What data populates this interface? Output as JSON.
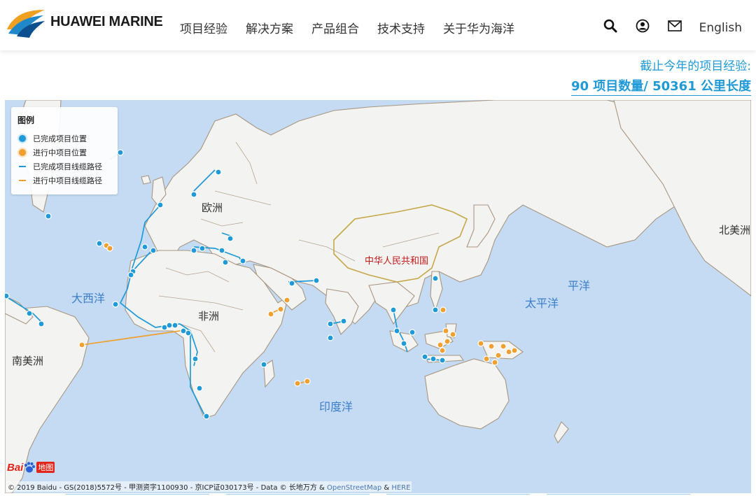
{
  "header": {
    "brand": "HUAWEI MARINE",
    "nav": [
      "项目经验",
      "解决方案",
      "产品组合",
      "技术支持",
      "关于华为海洋"
    ],
    "icons": [
      "search-icon",
      "user-icon",
      "mail-icon"
    ],
    "language": "English"
  },
  "stats": {
    "line1": "截止今年的项目经验:",
    "line2": "90 项目数量/ 50361 公里长度"
  },
  "legend": {
    "title": "图例",
    "items": [
      {
        "label": "已完成项目位置",
        "color": "#1f9ad7"
      },
      {
        "label": "进行中项目位置",
        "color": "#f0a030"
      },
      {
        "label": "已完成项目线缆路径",
        "color": "#1f9ad7"
      },
      {
        "label": "进行中项目线缆路径",
        "color": "#f0a030"
      }
    ]
  },
  "map": {
    "labels": {
      "europe": "欧洲",
      "africa": "非洲",
      "south_america": "南美洲",
      "north_america": "北美洲",
      "china": "中华人民共和国",
      "atlantic": "大西洋",
      "pacific_a": "平洋",
      "pacific_b": "太平洋",
      "indian": "印度洋"
    },
    "provider": {
      "bai": "Bai",
      "ditu": "地图"
    },
    "copyright_prefix": "© 2019 Baidu - GS(2018)5572号 - 甲测资字1100930 - 京ICP证030173号 - Data © 长地万方 & ",
    "copyright_osm": "OpenStreetMap",
    "copyright_amp": " & ",
    "copyright_here": "HERE"
  }
}
